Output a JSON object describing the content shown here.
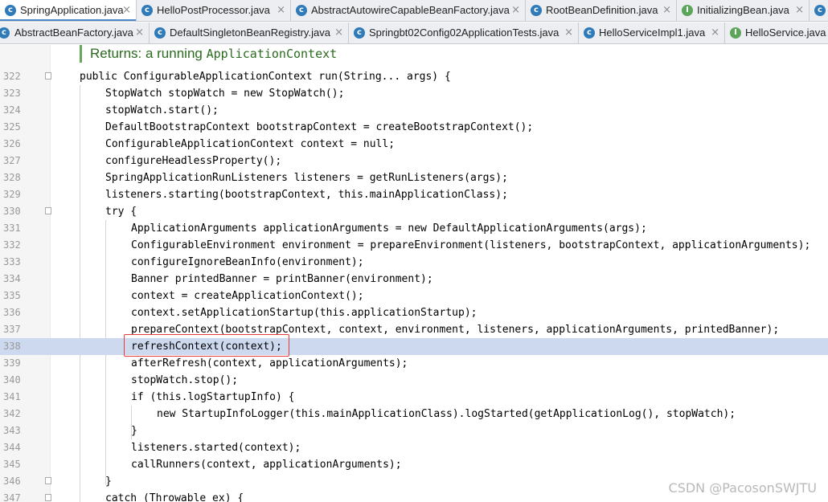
{
  "tabs_row1": [
    {
      "label": "SpringApplication.java",
      "icon": "c",
      "active": true
    },
    {
      "label": "HelloPostProcessor.java",
      "icon": "c",
      "active": false
    },
    {
      "label": "AbstractAutowireCapableBeanFactory.java",
      "icon": "c",
      "active": false
    },
    {
      "label": "RootBeanDefinition.java",
      "icon": "c",
      "active": false
    },
    {
      "label": "InitializingBean.java",
      "icon": "i",
      "active": false
    }
  ],
  "tabs_row2": [
    {
      "label": "AbstractBeanFactory.java",
      "icon": "c",
      "active": false
    },
    {
      "label": "DefaultSingletonBeanRegistry.java",
      "icon": "c",
      "active": false
    },
    {
      "label": "Springbt02Config02ApplicationTests.java",
      "icon": "c",
      "active": false
    },
    {
      "label": "HelloServiceImpl1.java",
      "icon": "c",
      "active": false
    },
    {
      "label": "HelloService.java",
      "icon": "i",
      "active": false
    }
  ],
  "close_glyph": "×",
  "doc_returns": "Returns: a running",
  "doc_type": "ApplicationContext",
  "code_lines": [
    {
      "n": "322",
      "t": "public ConfigurableApplicationContext run(String... args) {"
    },
    {
      "n": "323",
      "t": "StopWatch stopWatch = new StopWatch();"
    },
    {
      "n": "324",
      "t": "stopWatch.start();"
    },
    {
      "n": "325",
      "t": "DefaultBootstrapContext bootstrapContext = createBootstrapContext();"
    },
    {
      "n": "326",
      "t": "ConfigurableApplicationContext context = null;"
    },
    {
      "n": "327",
      "t": "configureHeadlessProperty();"
    },
    {
      "n": "328",
      "t": "SpringApplicationRunListeners listeners = getRunListeners(args);"
    },
    {
      "n": "329",
      "t": "listeners.starting(bootstrapContext, this.mainApplicationClass);"
    },
    {
      "n": "330",
      "t": "try {"
    },
    {
      "n": "331",
      "t": "ApplicationArguments applicationArguments = new DefaultApplicationArguments(args);"
    },
    {
      "n": "332",
      "t": "ConfigurableEnvironment environment = prepareEnvironment(listeners, bootstrapContext, applicationArguments);"
    },
    {
      "n": "333",
      "t": "configureIgnoreBeanInfo(environment);"
    },
    {
      "n": "334",
      "t": "Banner printedBanner = printBanner(environment);"
    },
    {
      "n": "335",
      "t": "context = createApplicationContext();"
    },
    {
      "n": "336",
      "t": "context.setApplicationStartup(this.applicationStartup);"
    },
    {
      "n": "337",
      "t": "prepareContext(bootstrapContext, context, environment, listeners, applicationArguments, printedBanner);"
    },
    {
      "n": "338",
      "t": "refreshContext(context);"
    },
    {
      "n": "339",
      "t": "afterRefresh(context, applicationArguments);"
    },
    {
      "n": "340",
      "t": "stopWatch.stop();"
    },
    {
      "n": "341",
      "t": "if (this.logStartupInfo) {"
    },
    {
      "n": "342",
      "t": "new StartupInfoLogger(this.mainApplicationClass).logStarted(getApplicationLog(), stopWatch);"
    },
    {
      "n": "343",
      "t": "}"
    },
    {
      "n": "344",
      "t": "listeners.started(context);"
    },
    {
      "n": "345",
      "t": "callRunners(context, applicationArguments);"
    },
    {
      "n": "346",
      "t": "}"
    },
    {
      "n": "347",
      "t": "catch (Throwable ex) {"
    }
  ],
  "watermark": "CSDN @PacosonSWJTU"
}
